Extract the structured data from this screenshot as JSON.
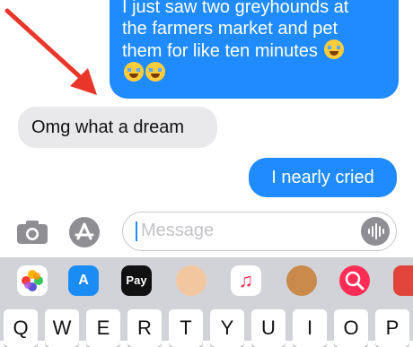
{
  "conversation": {
    "messages": [
      {
        "side": "outgoing",
        "lines": [
          "I just saw two greyhounds at",
          "the farmers market and pet",
          "them for like ten minutes"
        ],
        "emoji_count": 3
      },
      {
        "side": "incoming",
        "text": "Omg what a dream"
      },
      {
        "side": "outgoing",
        "text": "I nearly cried"
      }
    ]
  },
  "annotation": {
    "arrow_color": "#e8372a"
  },
  "input_bar": {
    "placeholder": "Message",
    "camera_icon": "camera-icon",
    "apps_icon": "app-store-icon",
    "audio_icon": "waveform-icon"
  },
  "app_strip": [
    {
      "name": "photos-app-icon"
    },
    {
      "name": "app-store-app-icon",
      "glyph": "A"
    },
    {
      "name": "apple-pay-app-icon",
      "label": "Pay"
    },
    {
      "name": "memoji-app-icon"
    },
    {
      "name": "music-app-icon",
      "glyph": "♫"
    },
    {
      "name": "animoji-app-icon"
    },
    {
      "name": "web-search-app-icon"
    }
  ],
  "keyboard": {
    "row1": [
      "Q",
      "W",
      "E",
      "R",
      "T",
      "Y",
      "U",
      "I",
      "O",
      "P"
    ]
  },
  "colors": {
    "outgoing_bubble": "#1f8bff",
    "incoming_bubble": "#e9e9eb",
    "keyboard_bg": "#d1d3d9"
  }
}
